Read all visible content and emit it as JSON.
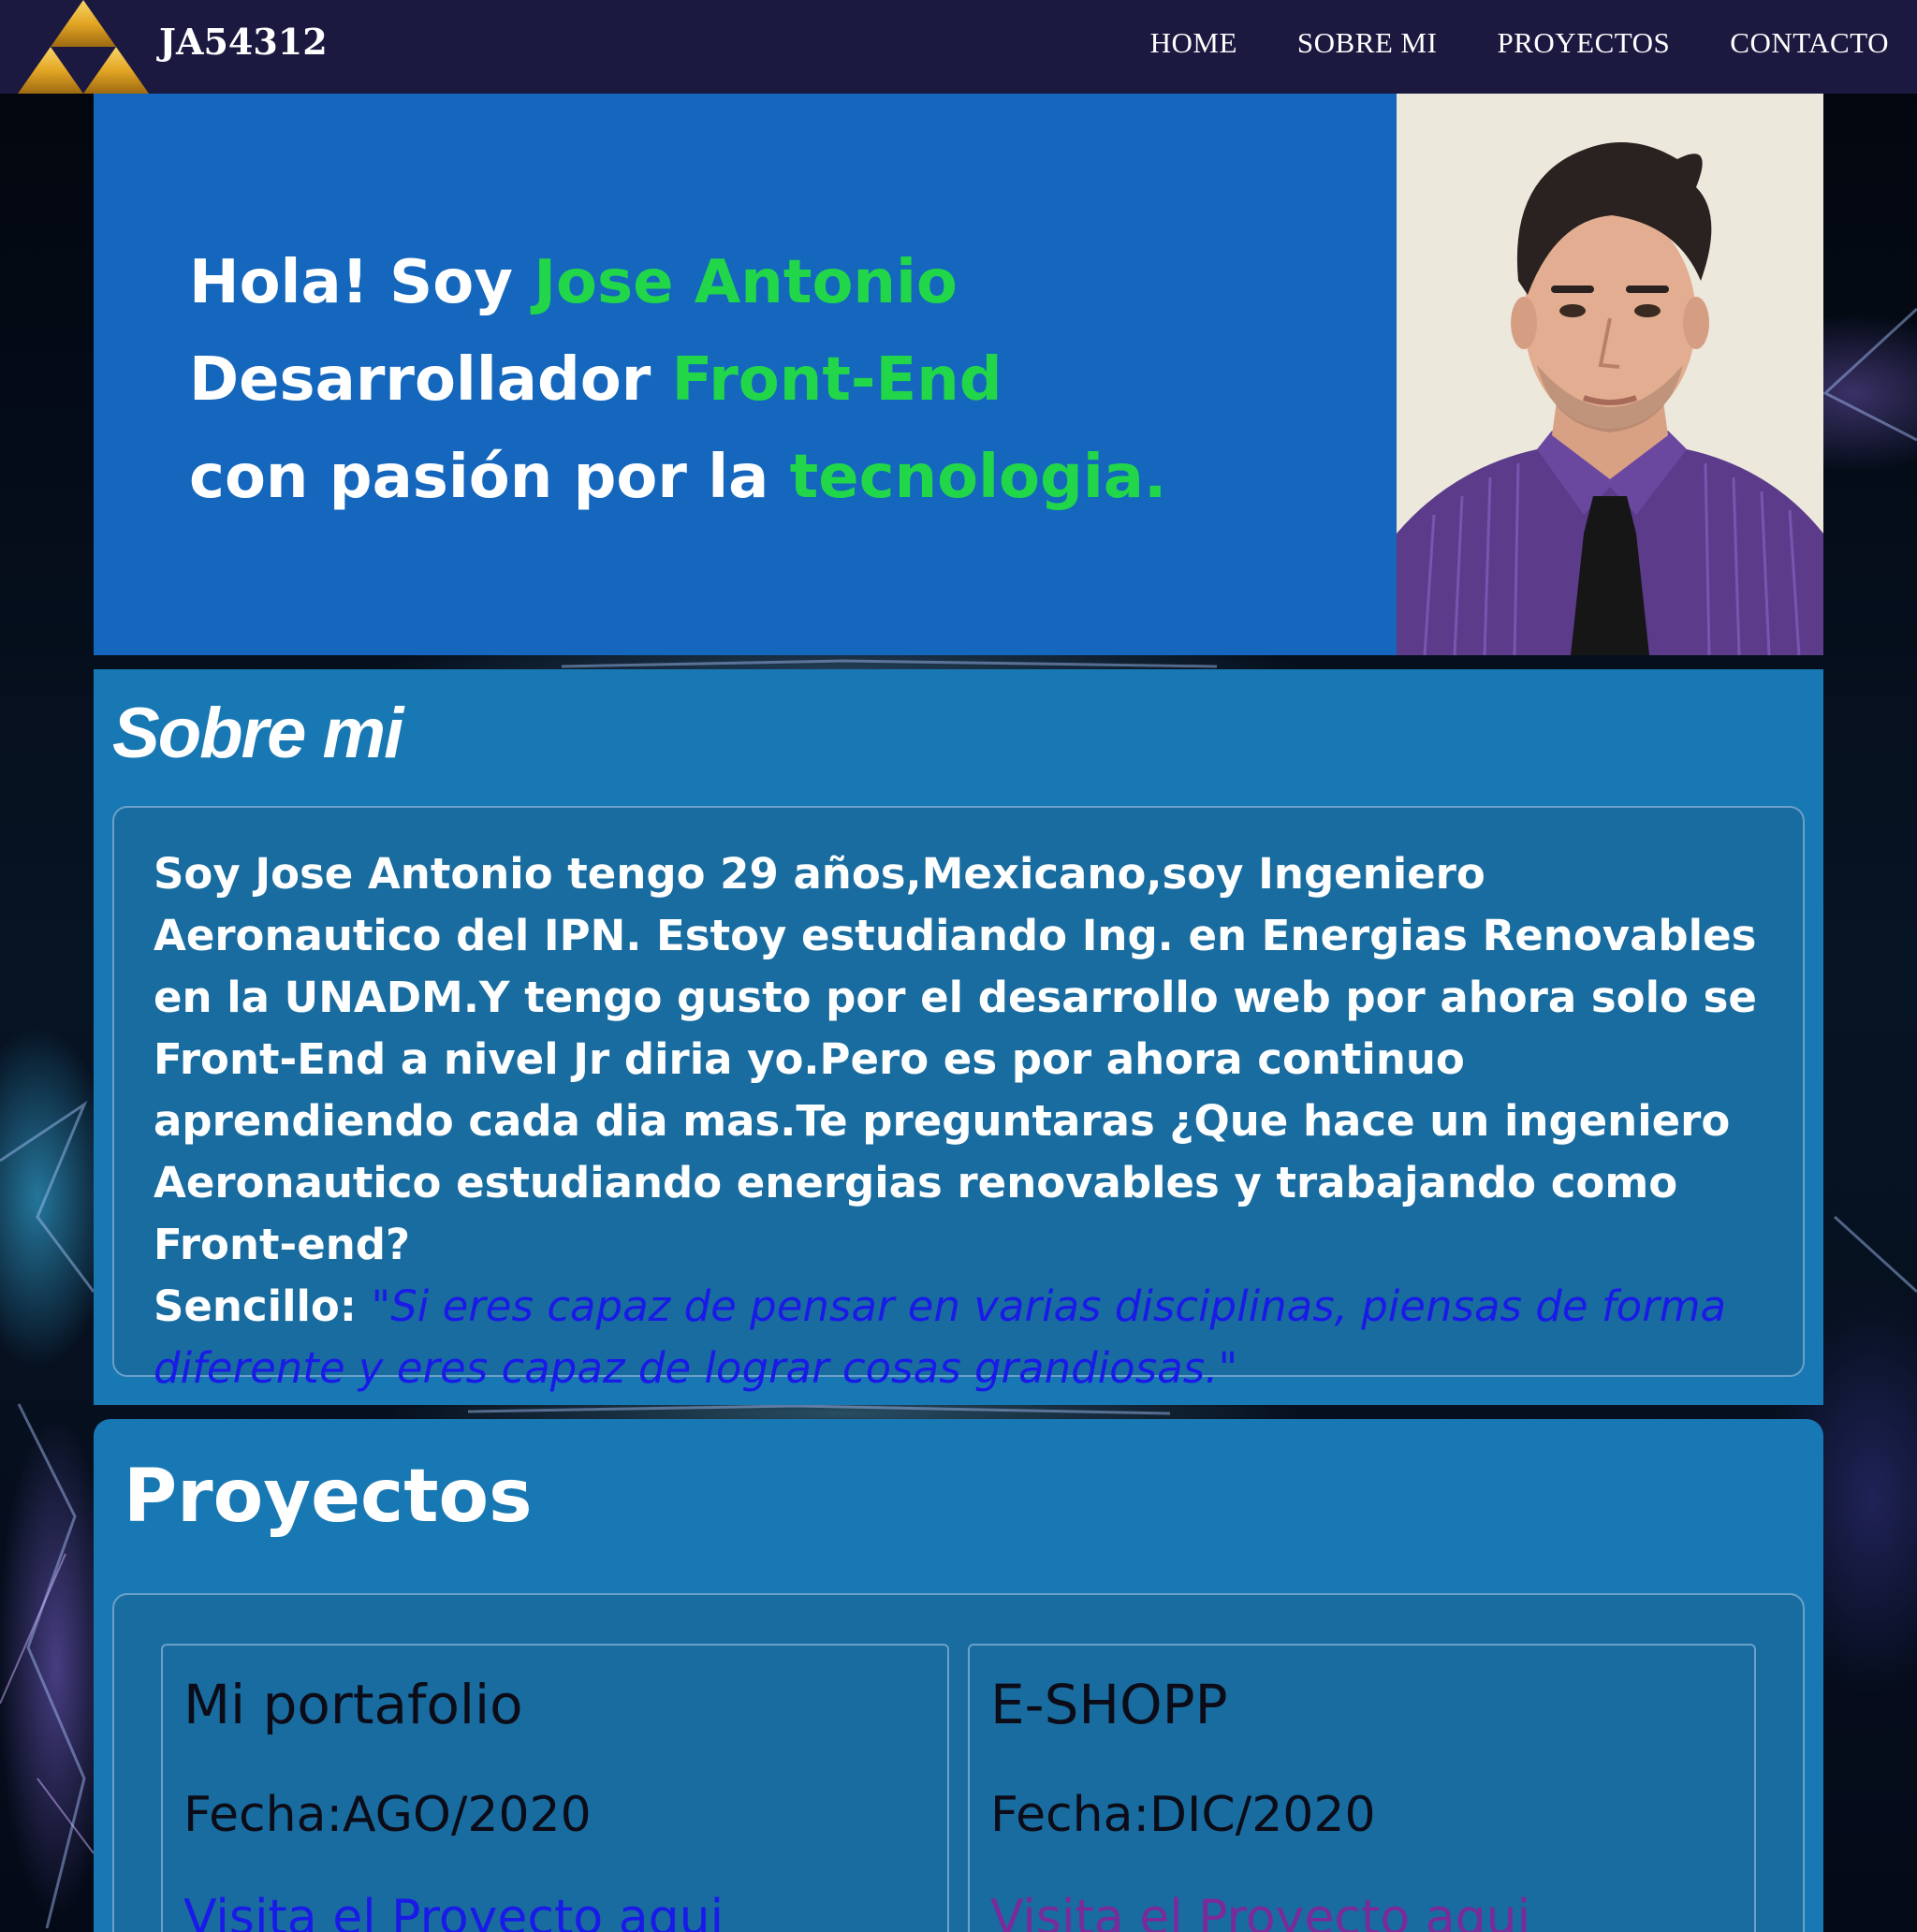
{
  "nav": {
    "brand": "JA54312",
    "links": [
      "HOME",
      "SOBRE MI",
      "PROYECTOS",
      "CONTACTO"
    ]
  },
  "hero": {
    "line1_a": "Hola! Soy ",
    "line1_b": "Jose Antonio",
    "line2_a": "Desarrollador ",
    "line2_b": "Front-End",
    "line3_a": "con pasión por la ",
    "line3_b": "tecnologia."
  },
  "about": {
    "title": "Sobre mi",
    "paragraph": "Soy Jose Antonio tengo 29 años,Mexicano,soy Ingeniero Aeronautico del IPN. Estoy estudiando Ing. en Energias Renovables en la UNADM.Y tengo gusto por el desarrollo web por ahora solo se Front-End a nivel Jr diria yo.Pero es por ahora continuo aprendiendo cada dia mas.Te preguntaras ¿Que hace un ingeniero Aeronautico estudiando energias renovables y trabajando como Front-end?",
    "lead": "Sencillo: ",
    "quote": "\"Si eres capaz de pensar en varias disciplinas, piensas de forma diferente y eres capaz de lograr cosas grandiosas.\""
  },
  "projects": {
    "title": "Proyectos",
    "items": [
      {
        "name": "Mi portafolio",
        "date": "Fecha:AGO/2020",
        "link": "Visita el Proyecto aqui",
        "link_color": "#1a1ae8"
      },
      {
        "name": "E-SHOPP",
        "date": "Fecha:DIC/2020",
        "link": "Visita el Proyecto aqui",
        "link_color": "#7a2a9a"
      }
    ]
  },
  "colors": {
    "navbar": "#1b1940",
    "hero_bg": "#1467bd",
    "highlight": "#22d64a",
    "section_bg": "#1878b3"
  }
}
